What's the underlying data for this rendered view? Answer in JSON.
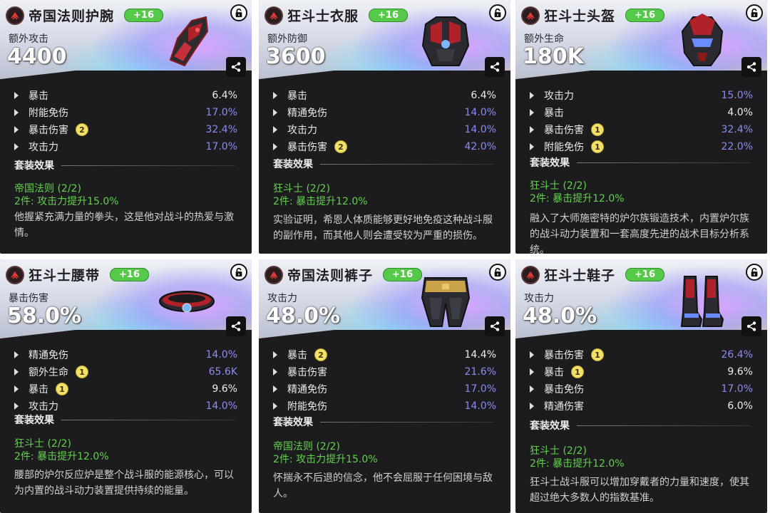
{
  "cards": [
    {
      "name": "帝国法则护腕",
      "level": "+16",
      "main_label": "额外攻击",
      "main_value": "4400",
      "stats": [
        {
          "label": "暴击",
          "value": "6.4%",
          "color": "#ececf0",
          "badge": ""
        },
        {
          "label": "附能免伤",
          "value": "17.0%",
          "color": "#8a8df0",
          "badge": ""
        },
        {
          "label": "暴击伤害",
          "value": "32.4%",
          "color": "#8a8df0",
          "badge": "2"
        },
        {
          "label": "攻击力",
          "value": "17.0%",
          "color": "#8a8df0",
          "badge": ""
        }
      ],
      "set_title": "套装效果",
      "set_name": "帝国法则 (2/2)",
      "set_bonus": "2件: 攻击力提升15.0%",
      "description": "他握紧充满力量的拳头，这是他对战斗的热爱与激情。",
      "art": "gauntlet"
    },
    {
      "name": "狂斗士衣服",
      "level": "+16",
      "main_label": "额外防御",
      "main_value": "3600",
      "stats": [
        {
          "label": "暴击",
          "value": "6.4%",
          "color": "#ececf0",
          "badge": ""
        },
        {
          "label": "精通免伤",
          "value": "14.0%",
          "color": "#8a8df0",
          "badge": ""
        },
        {
          "label": "攻击力",
          "value": "14.0%",
          "color": "#8a8df0",
          "badge": ""
        },
        {
          "label": "暴击伤害",
          "value": "42.0%",
          "color": "#8a8df0",
          "badge": "2"
        }
      ],
      "set_title": "套装效果",
      "set_name": "狂斗士 (2/2)",
      "set_bonus": "2件: 暴击提升12.0%",
      "description": "实验证明，希恩人体质能够更好地免疫这种战斗服的副作用，而其他人则会遭受较为严重的损伤。",
      "art": "armor"
    },
    {
      "name": "狂斗士头盔",
      "level": "+16",
      "main_label": "额外生命",
      "main_value": "180K",
      "stats": [
        {
          "label": "攻击力",
          "value": "15.0%",
          "color": "#8a8df0",
          "badge": ""
        },
        {
          "label": "暴击",
          "value": "4.0%",
          "color": "#ececf0",
          "badge": ""
        },
        {
          "label": "暴击伤害",
          "value": "32.4%",
          "color": "#8a8df0",
          "badge": "1"
        },
        {
          "label": "附能免伤",
          "value": "22.0%",
          "color": "#8a8df0",
          "badge": "1"
        }
      ],
      "set_title": "套装效果",
      "set_name": "狂斗士 (2/2)",
      "set_bonus": "2件: 暴击提升12.0%",
      "description": "融入了大师施密特的炉尔族锻造技术，内置炉尔族的战斗动力装置和一套高度先进的战术目标分析系统。",
      "art": "helmet"
    },
    {
      "name": "狂斗士腰带",
      "level": "+16",
      "main_label": "暴击伤害",
      "main_value": "58.0%",
      "stats": [
        {
          "label": "精通免伤",
          "value": "14.0%",
          "color": "#8a8df0",
          "badge": ""
        },
        {
          "label": "额外生命",
          "value": "65.6K",
          "color": "#8a8df0",
          "badge": "1"
        },
        {
          "label": "暴击",
          "value": "9.6%",
          "color": "#ececf0",
          "badge": "1"
        },
        {
          "label": "攻击力",
          "value": "14.0%",
          "color": "#8a8df0",
          "badge": ""
        }
      ],
      "set_title": "套装效果",
      "set_name": "狂斗士 (2/2)",
      "set_bonus": "2件: 暴击提升12.0%",
      "description": "腰部的炉尔反应炉是整个战斗服的能源核心，可以为内置的战斗动力装置提供持续的能量。",
      "art": "belt"
    },
    {
      "name": "帝国法则裤子",
      "level": "+16",
      "main_label": "攻击力",
      "main_value": "48.0%",
      "stats": [
        {
          "label": "暴击",
          "value": "14.4%",
          "color": "#ececf0",
          "badge": "2"
        },
        {
          "label": "暴击伤害",
          "value": "21.6%",
          "color": "#8a8df0",
          "badge": ""
        },
        {
          "label": "精通免伤",
          "value": "17.0%",
          "color": "#8a8df0",
          "badge": ""
        },
        {
          "label": "附能免伤",
          "value": "14.0%",
          "color": "#8a8df0",
          "badge": ""
        }
      ],
      "set_title": "套装效果",
      "set_name": "帝国法则 (2/2)",
      "set_bonus": "2件: 攻击力提升15.0%",
      "description": "怀揣永不后退的信念，他不会屈服于任何困境与敌人。",
      "art": "pants"
    },
    {
      "name": "狂斗士鞋子",
      "level": "+16",
      "main_label": "攻击力",
      "main_value": "48.0%",
      "stats": [
        {
          "label": "暴击伤害",
          "value": "26.4%",
          "color": "#8a8df0",
          "badge": "1"
        },
        {
          "label": "暴击",
          "value": "9.6%",
          "color": "#ececf0",
          "badge": "1"
        },
        {
          "label": "暴击免伤",
          "value": "17.0%",
          "color": "#8a8df0",
          "badge": ""
        },
        {
          "label": "精通伤害",
          "value": "6.0%",
          "color": "#ececf0",
          "badge": ""
        }
      ],
      "set_title": "套装效果",
      "set_name": "狂斗士 (2/2)",
      "set_bonus": "2件: 暴击提升12.0%",
      "description": "狂斗士战斗服可以增加穿戴者的力量和速度，使其超过绝大多数人的指数基准。",
      "art": "boots"
    }
  ]
}
